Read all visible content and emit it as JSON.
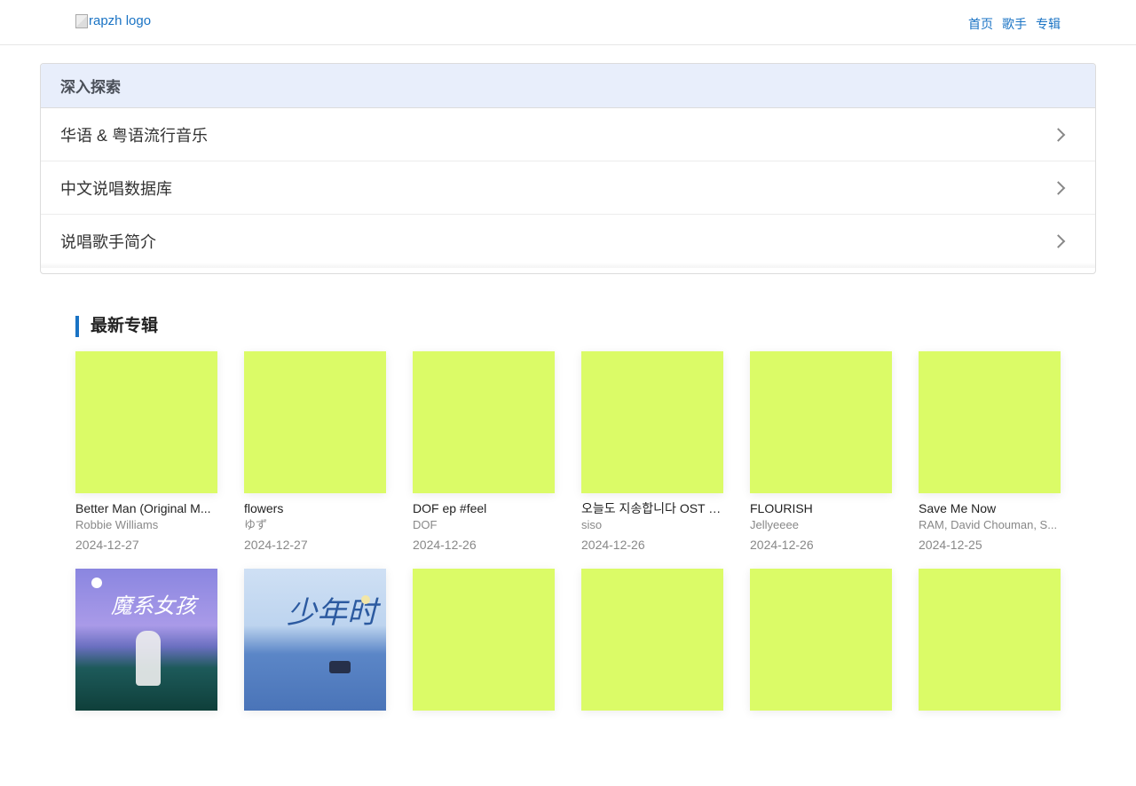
{
  "header": {
    "logo_alt": "rapzh logo",
    "nav": [
      "首页",
      "歌手",
      "专辑"
    ]
  },
  "explore": {
    "title": "深入探索",
    "items": [
      "华语 & 粤语流行音乐",
      "中文说唱数据库",
      "说唱歌手简介"
    ]
  },
  "albums_section": {
    "title": "最新专辑",
    "albums": [
      {
        "title": "Better Man (Original M...",
        "artist": "Robbie Williams",
        "date": "2024-12-27"
      },
      {
        "title": "flowers",
        "artist": "ゆず",
        "date": "2024-12-27"
      },
      {
        "title": "DOF ep #feel",
        "artist": "DOF",
        "date": "2024-12-26"
      },
      {
        "title": "오늘도 지송합니다 OST P...",
        "artist": "siso",
        "date": "2024-12-26"
      },
      {
        "title": "FLOURISH",
        "artist": "Jellyeeee",
        "date": "2024-12-26"
      },
      {
        "title": "Save Me Now",
        "artist": "RAM, David Chouman, S...",
        "date": "2024-12-25"
      }
    ],
    "second_row_cover_text": [
      "魔系女孩",
      "少年时"
    ]
  },
  "colors": {
    "accent": "#1a73c4",
    "placeholder_cover": "#dbfb67",
    "panel_header_bg": "#e8eefb"
  }
}
